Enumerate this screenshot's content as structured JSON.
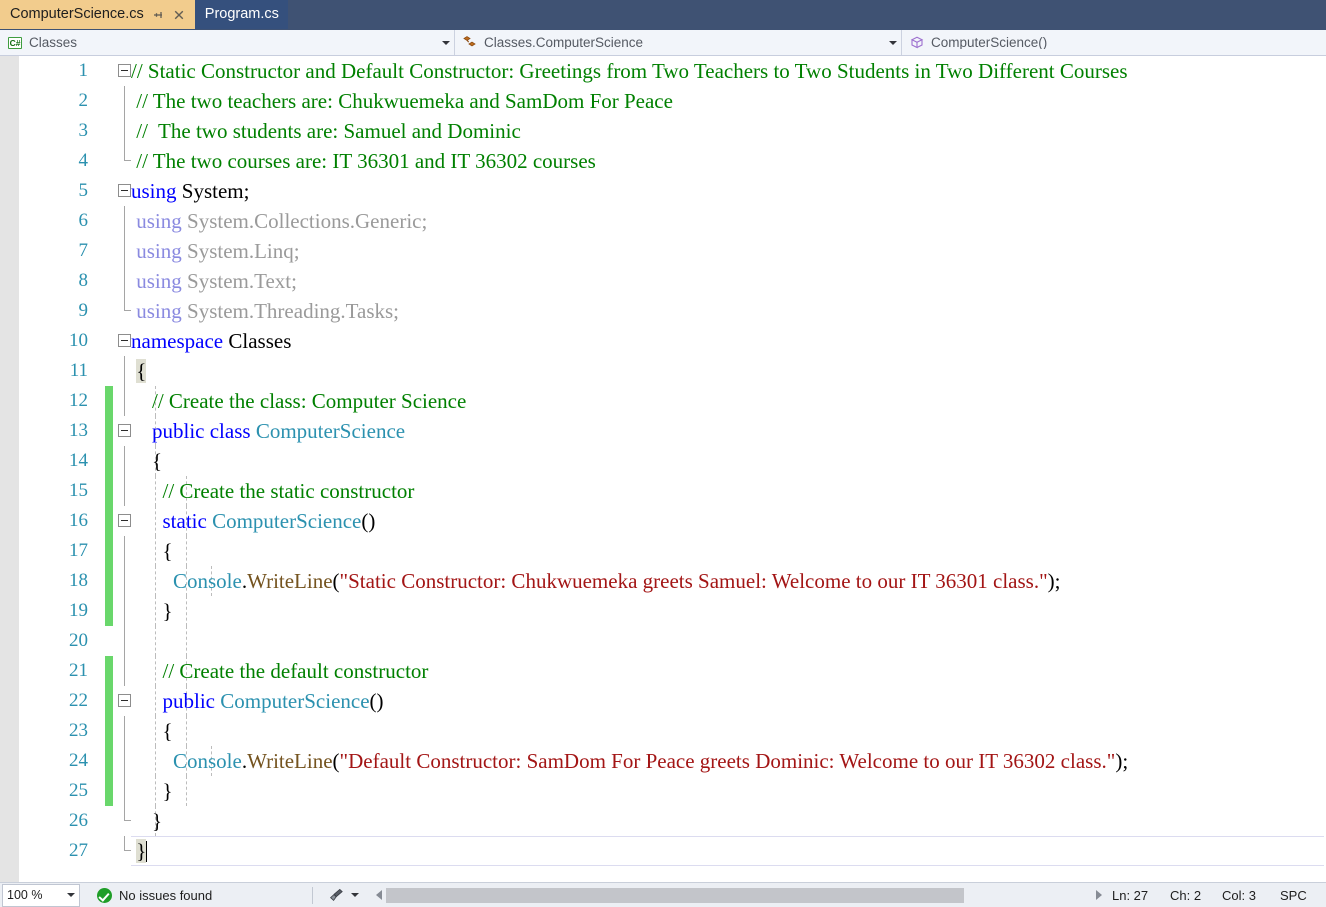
{
  "tabs": [
    {
      "title": "ComputerScience.cs",
      "active": true,
      "pin_icon": "pin-icon",
      "close_icon": "close-icon"
    },
    {
      "title": "Program.cs",
      "active": false
    }
  ],
  "navbar": {
    "project": {
      "icon": "csharp-file-icon",
      "label": "Classes"
    },
    "type": {
      "icon": "class-icon",
      "label": "Classes.ComputerScience"
    },
    "member": {
      "icon": "method-icon",
      "label": "ComputerScience()"
    }
  },
  "editor": {
    "lines": [
      {
        "n": 1,
        "changed": false,
        "outline": "box-start",
        "indent_guides": [],
        "segments": [
          {
            "t": "// Static Constructor and Default Constructor: Greetings from Two Teachers to Two Students in Two Different Courses",
            "c": "t-comment"
          }
        ]
      },
      {
        "n": 2,
        "changed": false,
        "outline": "line",
        "indent_guides": [],
        "segments": [
          {
            "t": " // The two teachers are: Chukwuemeka and SamDom For Peace",
            "c": "t-comment"
          }
        ]
      },
      {
        "n": 3,
        "changed": false,
        "outline": "line",
        "indent_guides": [],
        "segments": [
          {
            "t": " //  The two students are: Samuel and Dominic",
            "c": "t-comment"
          }
        ]
      },
      {
        "n": 4,
        "changed": false,
        "outline": "line-end",
        "indent_guides": [],
        "segments": [
          {
            "t": " // The two courses are: IT 36301 and IT 36302 courses",
            "c": "t-comment"
          }
        ]
      },
      {
        "n": 5,
        "changed": false,
        "outline": "box-start",
        "indent_guides": [],
        "segments": [
          {
            "t": "using",
            "c": "t-keyword"
          },
          {
            "t": " System;",
            "c": "t-plain"
          }
        ]
      },
      {
        "n": 6,
        "changed": false,
        "outline": "line",
        "indent_guides": [],
        "segments": [
          {
            "t": " using",
            "c": "t-dim-kw"
          },
          {
            "t": " System.Collections.Generic;",
            "c": "t-dim"
          }
        ]
      },
      {
        "n": 7,
        "changed": false,
        "outline": "line",
        "indent_guides": [],
        "segments": [
          {
            "t": " using",
            "c": "t-dim-kw"
          },
          {
            "t": " System.Linq;",
            "c": "t-dim"
          }
        ]
      },
      {
        "n": 8,
        "changed": false,
        "outline": "line",
        "indent_guides": [],
        "segments": [
          {
            "t": " using",
            "c": "t-dim-kw"
          },
          {
            "t": " System.Text;",
            "c": "t-dim"
          }
        ]
      },
      {
        "n": 9,
        "changed": false,
        "outline": "line-end",
        "indent_guides": [],
        "segments": [
          {
            "t": " using",
            "c": "t-dim-kw"
          },
          {
            "t": " System.Threading.Tasks;",
            "c": "t-dim"
          }
        ]
      },
      {
        "n": 10,
        "changed": false,
        "outline": "box-start",
        "indent_guides": [],
        "segments": [
          {
            "t": "namespace",
            "c": "t-keyword"
          },
          {
            "t": " Classes",
            "c": "t-plain"
          }
        ]
      },
      {
        "n": 11,
        "changed": false,
        "outline": "line",
        "indent_guides": [],
        "segments": [
          {
            "t": " ",
            "c": "t-plain"
          },
          {
            "t": "{",
            "c": "t-plain brace-hl"
          }
        ]
      },
      {
        "n": 12,
        "changed": true,
        "outline": "line",
        "indent_guides": [
          24
        ],
        "segments": [
          {
            "t": "    // Create the class: Computer Science",
            "c": "t-comment"
          }
        ]
      },
      {
        "n": 13,
        "changed": true,
        "outline": "box",
        "indent_guides": [
          24
        ],
        "segments": [
          {
            "t": "    public class",
            "c": "t-keyword"
          },
          {
            "t": " ComputerScience",
            "c": "t-type"
          }
        ]
      },
      {
        "n": 14,
        "changed": true,
        "outline": "line",
        "indent_guides": [
          24
        ],
        "segments": [
          {
            "t": "    {",
            "c": "t-plain"
          }
        ]
      },
      {
        "n": 15,
        "changed": true,
        "outline": "line",
        "indent_guides": [
          24,
          55
        ],
        "segments": [
          {
            "t": "      // Create the static constructor",
            "c": "t-comment"
          }
        ]
      },
      {
        "n": 16,
        "changed": true,
        "outline": "box",
        "indent_guides": [
          24,
          55
        ],
        "segments": [
          {
            "t": "      static",
            "c": "t-keyword"
          },
          {
            "t": " ComputerScience",
            "c": "t-type"
          },
          {
            "t": "()",
            "c": "t-plain"
          }
        ]
      },
      {
        "n": 17,
        "changed": true,
        "outline": "line",
        "indent_guides": [
          24,
          55
        ],
        "segments": [
          {
            "t": "      {",
            "c": "t-plain"
          }
        ]
      },
      {
        "n": 18,
        "changed": true,
        "outline": "line",
        "indent_guides": [
          24,
          55,
          80
        ],
        "segments": [
          {
            "t": "        ",
            "c": "t-plain"
          },
          {
            "t": "Console",
            "c": "t-type"
          },
          {
            "t": ".",
            "c": "t-plain"
          },
          {
            "t": "WriteLine",
            "c": "t-method"
          },
          {
            "t": "(",
            "c": "t-plain"
          },
          {
            "t": "\"Static Constructor: Chukwuemeka greets Samuel: Welcome to our IT 36301 class.\"",
            "c": "t-string"
          },
          {
            "t": ");",
            "c": "t-plain"
          }
        ]
      },
      {
        "n": 19,
        "changed": true,
        "outline": "line",
        "indent_guides": [
          24,
          55
        ],
        "segments": [
          {
            "t": "      }",
            "c": "t-plain"
          }
        ]
      },
      {
        "n": 20,
        "changed": false,
        "outline": "line",
        "indent_guides": [
          24,
          55
        ],
        "segments": [
          {
            "t": "",
            "c": "t-plain"
          }
        ]
      },
      {
        "n": 21,
        "changed": true,
        "outline": "line",
        "indent_guides": [
          24,
          55
        ],
        "segments": [
          {
            "t": "      // Create the default constructor",
            "c": "t-comment"
          }
        ]
      },
      {
        "n": 22,
        "changed": true,
        "outline": "box",
        "indent_guides": [
          24,
          55
        ],
        "segments": [
          {
            "t": "      public",
            "c": "t-keyword"
          },
          {
            "t": " ComputerScience",
            "c": "t-type"
          },
          {
            "t": "()",
            "c": "t-plain"
          }
        ]
      },
      {
        "n": 23,
        "changed": true,
        "outline": "line",
        "indent_guides": [
          24,
          55
        ],
        "segments": [
          {
            "t": "      {",
            "c": "t-plain"
          }
        ]
      },
      {
        "n": 24,
        "changed": true,
        "outline": "line",
        "indent_guides": [
          24,
          55,
          80
        ],
        "segments": [
          {
            "t": "        ",
            "c": "t-plain"
          },
          {
            "t": "Console",
            "c": "t-type"
          },
          {
            "t": ".",
            "c": "t-plain"
          },
          {
            "t": "WriteLine",
            "c": "t-method"
          },
          {
            "t": "(",
            "c": "t-plain"
          },
          {
            "t": "\"Default Constructor: SamDom For Peace greets Dominic: Welcome to our IT 36302 class.\"",
            "c": "t-string"
          },
          {
            "t": ");",
            "c": "t-plain"
          }
        ]
      },
      {
        "n": 25,
        "changed": true,
        "outline": "line",
        "indent_guides": [
          24,
          55
        ],
        "segments": [
          {
            "t": "      }",
            "c": "t-plain"
          }
        ]
      },
      {
        "n": 26,
        "changed": false,
        "outline": "line-end",
        "indent_guides": [
          24
        ],
        "segments": [
          {
            "t": "    }",
            "c": "t-plain"
          }
        ]
      },
      {
        "n": 27,
        "changed": false,
        "outline": "line-end",
        "current": true,
        "indent_guides": [],
        "segments": [
          {
            "t": " ",
            "c": "t-plain"
          },
          {
            "t": "}",
            "c": "t-plain brace-hl"
          }
        ]
      }
    ]
  },
  "statusbar": {
    "zoom": "100 %",
    "issues_label": "No issues found",
    "issues_icon": "check-circle-icon",
    "brush_icon": "brush-icon",
    "ln": "Ln: 27",
    "ch": "Ch: 2",
    "col": "Col: 3",
    "ins_mode": "SPC"
  },
  "colors": {
    "tab_active_bg": "#f2cc8d",
    "tab_inactive_bg": "#35507d",
    "tabstrip_bg": "#3f5273",
    "changebar_green": "#69d76b",
    "comment_green": "#008000",
    "keyword_blue": "#0000ff",
    "type_teal": "#2b91af",
    "string_red": "#a31515",
    "method_olive": "#74531f",
    "status_ok_green": "#1f9e28"
  }
}
